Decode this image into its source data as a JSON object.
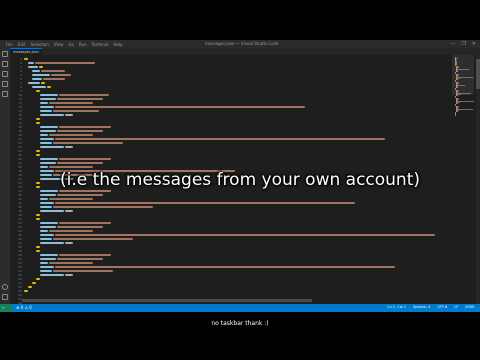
{
  "window": {
    "title": "messages.json — Visual Studio Code",
    "menu": [
      "File",
      "Edit",
      "Selection",
      "View",
      "Go",
      "Run",
      "Terminal",
      "Help"
    ],
    "controls": [
      "—",
      "❐",
      "✕"
    ]
  },
  "tab": {
    "label": "messages.json"
  },
  "editor": {
    "total_lines": 62
  },
  "statusbar": {
    "remote": "⌁",
    "problems": "⊗ 0 ⚠ 0",
    "items": [
      "Ln 1, Col 1",
      "Spaces: 4",
      "UTF-8",
      "LF",
      "JSON"
    ]
  },
  "overlay_caption": "(i.e the messages from your own account)",
  "subtitle": "no taskbar thank :)",
  "colors": {
    "key": "#9cdcfe",
    "string": "#ce9178",
    "number": "#b5cea8",
    "punct": "#d4d4d4",
    "bracket": "#ffd700",
    "statusbar": "#007acc"
  }
}
